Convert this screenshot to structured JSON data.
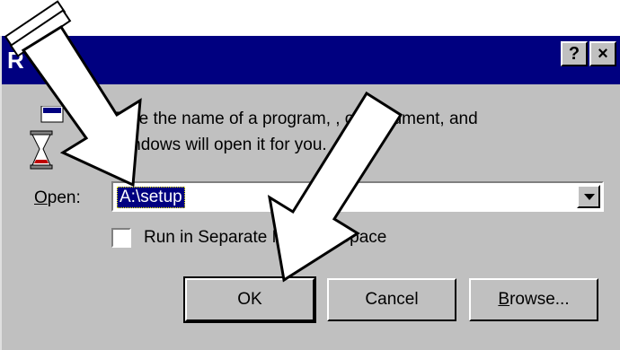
{
  "window": {
    "title": "R",
    "help_glyph": "?",
    "close_glyph": "×"
  },
  "prompt": {
    "line1": "Type the name of a program, , or document, and",
    "line2": "Windows will open it for you."
  },
  "open": {
    "label_accel": "O",
    "label_rest": "pen:",
    "value": "A:\\setup"
  },
  "run_separate": {
    "label": "Run in Separate Memory Space",
    "checked": false
  },
  "buttons": {
    "ok": "OK",
    "cancel": "Cancel",
    "browse_accel": "B",
    "browse_rest": "rowse..."
  },
  "colors": {
    "titlebar": "#000080",
    "face": "#c0c0c0",
    "selection": "#000080"
  },
  "icons": [
    "run-hourglass-icon",
    "pointer-arrow-icon"
  ]
}
